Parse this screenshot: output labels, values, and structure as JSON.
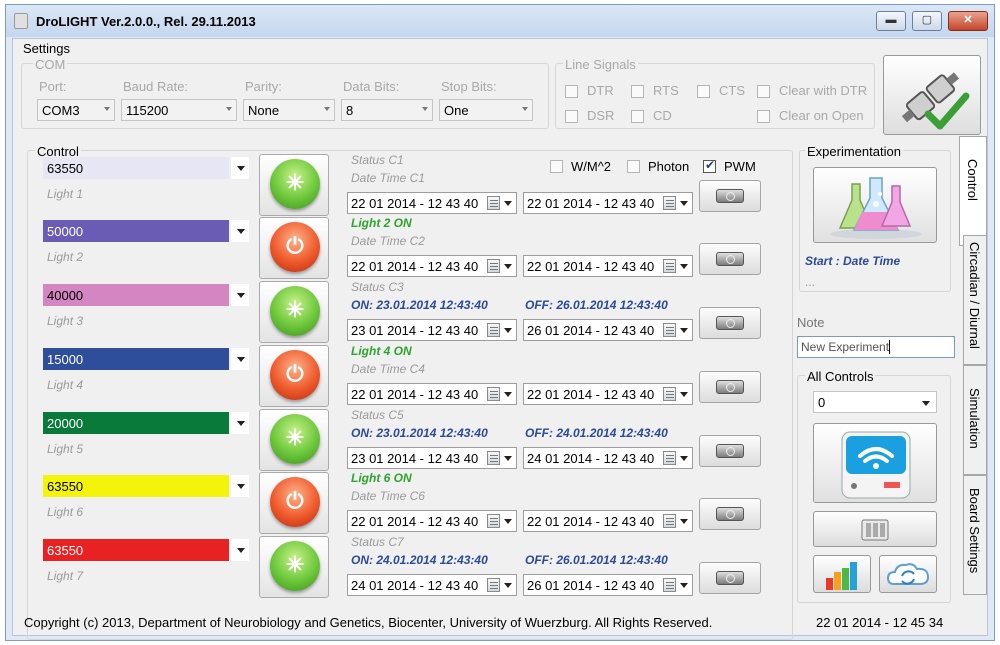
{
  "window": {
    "title": "DroLIGHT Ver.2.0.0., Rel. 29.11.2013",
    "minimize": "▬",
    "maximize": "▢",
    "close": "✕"
  },
  "settings": {
    "title": "Settings",
    "com_title": "COM",
    "port": {
      "label": "Port:",
      "value": "COM3"
    },
    "baud": {
      "label": "Baud Rate:",
      "value": "115200"
    },
    "parity": {
      "label": "Parity:",
      "value": "None"
    },
    "databits": {
      "label": "Data Bits:",
      "value": "8"
    },
    "stopbits": {
      "label": "Stop Bits:",
      "value": "One"
    },
    "line_signals": {
      "title": "Line Signals",
      "dtr": "DTR",
      "rts": "RTS",
      "cts": "CTS",
      "clear_dtr": "Clear with DTR",
      "dsr": "DSR",
      "cd": "CD",
      "clear_open": "Clear on Open"
    },
    "connect_icon": "connected-plug-icon"
  },
  "control": {
    "title": "Control",
    "options": {
      "wm2": "W/M^2",
      "photon": "Photon",
      "pwm": "PWM",
      "pwm_checked": true
    },
    "lights": [
      {
        "value": "63550",
        "name": "Light 1",
        "color": "#e6e6f4",
        "text_color": "#000000",
        "state": "on"
      },
      {
        "value": "50000",
        "name": "Light 2",
        "color": "#6a5cb4",
        "text_color": "#ffffff",
        "state": "off"
      },
      {
        "value": "40000",
        "name": "Light 3",
        "color": "#d486c2",
        "text_color": "#000000",
        "state": "on"
      },
      {
        "value": "15000",
        "name": "Light 4",
        "color": "#2e4e9c",
        "text_color": "#ffffff",
        "state": "off"
      },
      {
        "value": "20000",
        "name": "Light 5",
        "color": "#0a7a3a",
        "text_color": "#ffffff",
        "state": "on"
      },
      {
        "value": "63550",
        "name": "Light 6",
        "color": "#f4f40a",
        "text_color": "#000000",
        "state": "off"
      },
      {
        "value": "63550",
        "name": "Light 7",
        "color": "#e82222",
        "text_color": "#ffffff",
        "state": "on"
      }
    ],
    "channels": [
      {
        "status": "Status C1",
        "info": "Date Time C1",
        "date_on": "22 01 2014 - 12 43 40",
        "date_off": "22 01 2014 - 12 43 40"
      },
      {
        "status": "Light 2 ON",
        "info": "Date Time C2",
        "date_on": "22 01 2014 - 12 43 40",
        "date_off": "22 01 2014 - 12 43 40"
      },
      {
        "status": "Status C3",
        "on_text": "ON: 23.01.2014 12:43:40",
        "off_text": "OFF: 26.01.2014 12:43:40",
        "date_on": "23 01 2014 - 12 43 40",
        "date_off": "26 01 2014 - 12 43 40"
      },
      {
        "status": "Light 4 ON",
        "info": "Date Time C4",
        "date_on": "22 01 2014 - 12 43 40",
        "date_off": "22 01 2014 - 12 43 40"
      },
      {
        "status": "Status C5",
        "on_text": "ON: 23.01.2014 12:43:40",
        "off_text": "OFF: 24.01.2014 12:43:40",
        "date_on": "23 01 2014 - 12 43 40",
        "date_off": "24 01 2014 - 12 43 40"
      },
      {
        "status": "Light 6 ON",
        "info": "Date Time C6",
        "date_on": "22 01 2014 - 12 43 40",
        "date_off": "22 01 2014 - 12 43 40"
      },
      {
        "status": "Status C7",
        "on_text": "ON: 24.01.2014 12:43:40",
        "off_text": "OFF: 26.01.2014 12:43:40",
        "date_on": "24 01 2014 - 12 43 40",
        "date_off": "26 01 2014 - 12 43 40"
      }
    ]
  },
  "experimentation": {
    "title": "Experimentation",
    "start_label": "Start : Date Time",
    "start_value": "...",
    "note_label": "Note",
    "note_value": "New Experiment",
    "all_controls_title": "All Controls",
    "all_controls_value": "0"
  },
  "tabs": [
    {
      "label": "Control",
      "active": true
    },
    {
      "label": "Circadian / Diurnal",
      "active": false
    },
    {
      "label": "Simulation",
      "active": false
    },
    {
      "label": "Board Settings",
      "active": false
    }
  ],
  "footer": {
    "copyright": "Copyright (c) 2013, Department of Neurobiology and Genetics, Biocenter, University of Wuerzburg. All Rights Reserved.",
    "datetime": "22 01 2014 - 12 45 34"
  },
  "colors": {
    "on_button": "#5cc12f",
    "off_button": "#e84c24",
    "status_blue": "#2c4a9a",
    "status_green": "#2ea52e"
  }
}
